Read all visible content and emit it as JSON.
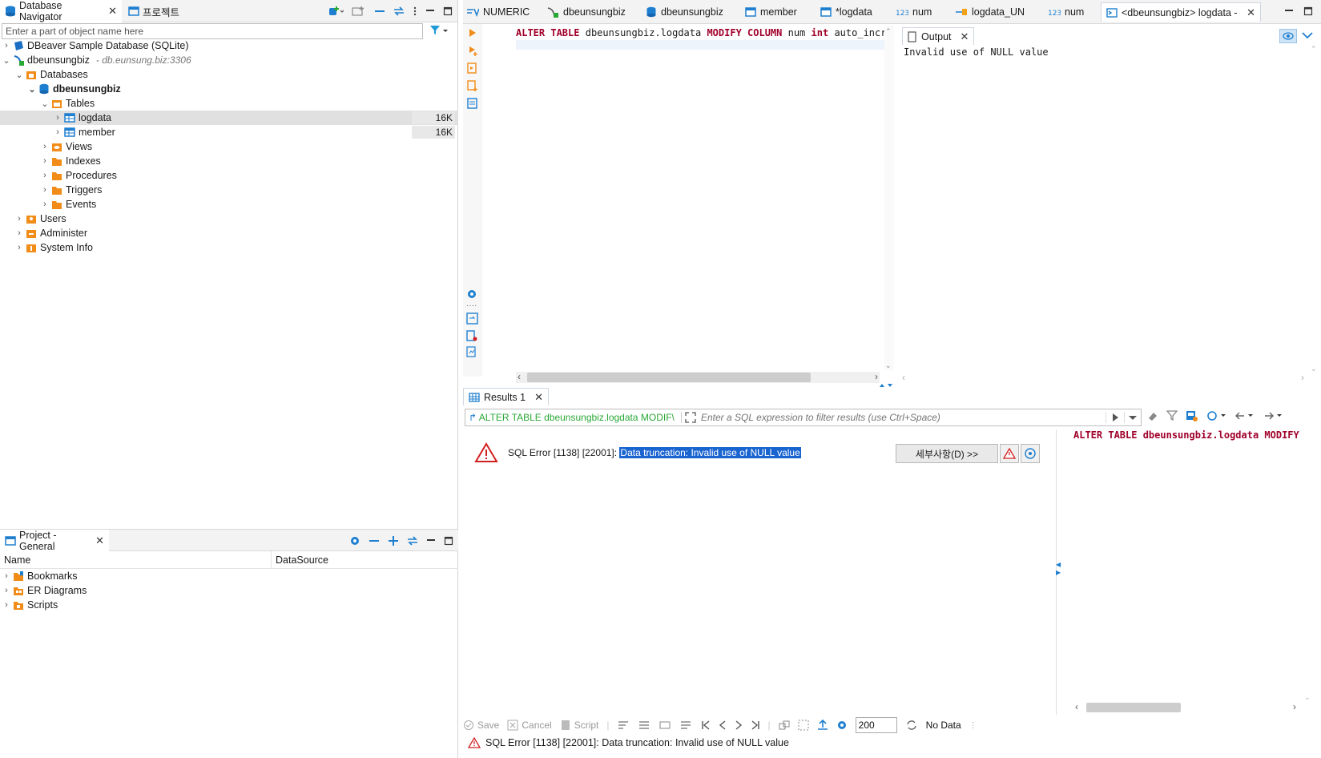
{
  "left_panel": {
    "tab_navigator": "Database Navigator",
    "tab_project": "프로젝트",
    "filter_placeholder": "Enter a part of object name here",
    "tree": {
      "sample_db": "DBeaver Sample Database (SQLite)",
      "conn_name": "dbeunsungbiz",
      "conn_host": "- db.eunsung.biz:3306",
      "databases": "Databases",
      "schema": "dbeunsungbiz",
      "tables": "Tables",
      "table1": "logdata",
      "table1_size": "16K",
      "table2": "member",
      "table2_size": "16K",
      "views": "Views",
      "indexes": "Indexes",
      "procedures": "Procedures",
      "triggers": "Triggers",
      "events": "Events",
      "users": "Users",
      "administer": "Administer",
      "system_info": "System Info"
    }
  },
  "project_panel": {
    "tab": "Project - General",
    "col_name": "Name",
    "col_datasource": "DataSource",
    "items": [
      "Bookmarks",
      "ER Diagrams",
      "Scripts"
    ]
  },
  "editor_tabs": [
    "NUMERIC",
    "dbeunsungbiz",
    "dbeunsungbiz",
    "member",
    "*logdata",
    "num",
    "logdata_UN",
    "num",
    "<dbeunsungbiz> logdata - ..."
  ],
  "editor": {
    "sql_kw1": "ALTER TABLE",
    "sql_ident": "dbeunsungbiz.logdata",
    "sql_kw2": "MODIFY COLUMN",
    "sql_col": "num",
    "sql_type": "int",
    "sql_rest": "auto_increr"
  },
  "output": {
    "tab": "Output",
    "text": "Invalid use of NULL value"
  },
  "results": {
    "tab": "Results 1",
    "query_preview": "ALTER TABLE dbeunsungbiz.logdata MODIF\\",
    "filter_placeholder": "Enter a SQL expression to filter results (use Ctrl+Space)",
    "error_prefix": "SQL Error [1138] [22001]: ",
    "error_selected": "Data truncation: Invalid use of NULL value",
    "details_button": "세부사항(D) >>",
    "side_sql": "ALTER TABLE dbeunsungbiz.logdata MODIFY"
  },
  "bottom_bar": {
    "save": "Save",
    "cancel": "Cancel",
    "script": "Script",
    "fetch_size": "200",
    "no_data": "No Data"
  },
  "status": {
    "message": "SQL Error [1138] [22001]: Data truncation: Invalid use of NULL value"
  },
  "colors": {
    "accent": "#1a64d0",
    "folder": "#f28c18",
    "db_blue": "#1e7fd0",
    "error_red": "#d22020",
    "keyword": "#7f0055"
  }
}
